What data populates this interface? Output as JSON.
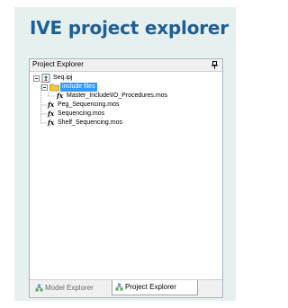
{
  "card": {
    "title": "IVE project explorer"
  },
  "panel": {
    "title": "Project Explorer"
  },
  "tree": {
    "root": "Seq.ipj",
    "folder": "include files",
    "include_file": "Master_Include\\IO_Procedures.mos",
    "files": [
      "Peg_Sequencing.mos",
      "Sequencing.mos",
      "Shelf_Sequencing.mos"
    ],
    "fx_glyph": "fx"
  },
  "tabs": [
    {
      "label": "Model Explorer",
      "active": false
    },
    {
      "label": "Project Explorer",
      "active": true
    }
  ],
  "colors": {
    "title": "#1d5f96",
    "card_background": "#e6f0ee",
    "selection": "#3399ff",
    "folder": "#f5c542"
  }
}
